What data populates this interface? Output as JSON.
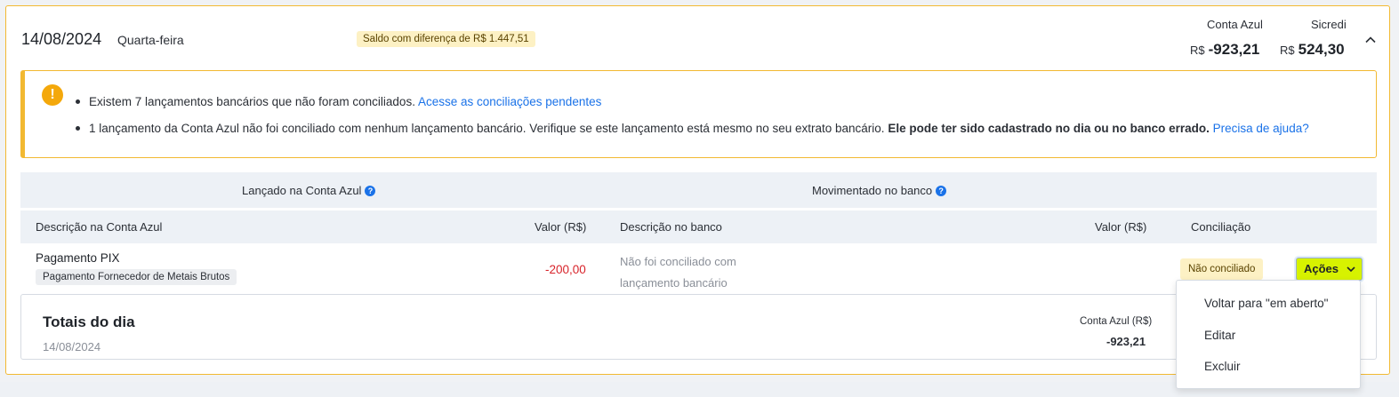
{
  "header": {
    "date": "14/08/2024",
    "weekday": "Quarta-feira",
    "difference_badge": "Saldo com diferença de R$ 1.447,51",
    "accounts": [
      {
        "name": "Conta Azul",
        "currency": "R$",
        "amount": "-923,21"
      },
      {
        "name": "Sicredi",
        "currency": "R$",
        "amount": "524,30"
      }
    ],
    "collapse_icon": "chevron-up-icon"
  },
  "alert": {
    "icon": "warning-icon",
    "line1_text": "Existem 7 lançamentos bancários que não foram conciliados.",
    "line1_link": "Acesse as conciliações pendentes",
    "line2_text": "1 lançamento da Conta Azul não foi conciliado com nenhum lançamento bancário. Verifique se este lançamento está mesmo no seu extrato bancário.",
    "line2_bold": "Ele pode ter sido cadastrado no dia ou no banco errado.",
    "line2_link": "Precisa de ajuda?"
  },
  "groups": {
    "left": "Lançado na Conta Azul",
    "right": "Movimentado no banco",
    "help_icon": "help-icon"
  },
  "table": {
    "columns": [
      "Descrição na Conta Azul",
      "Valor (R$)",
      "Descrição no banco",
      "Valor (R$)",
      "Conciliação"
    ],
    "row": {
      "description": "Pagamento PIX",
      "tag": "Pagamento Fornecedor de Metais Brutos",
      "value": "-200,00",
      "bank_description": "Não foi conciliado com lançamento bancário",
      "status": "Não conciliado",
      "actions_label": "Ações"
    }
  },
  "totals": {
    "title": "Totais do dia",
    "date": "14/08/2024",
    "label": "Conta Azul (R$)",
    "value": "-923,21"
  },
  "actions_menu": {
    "items": [
      "Voltar para \"em aberto\"",
      "Editar",
      "Excluir"
    ]
  },
  "colors": {
    "border_warning": "#f2b932",
    "link": "#1a72e8",
    "negative": "#d8232a",
    "actions_button": "#d7f200",
    "badge_bg": "#fdf1c4"
  }
}
